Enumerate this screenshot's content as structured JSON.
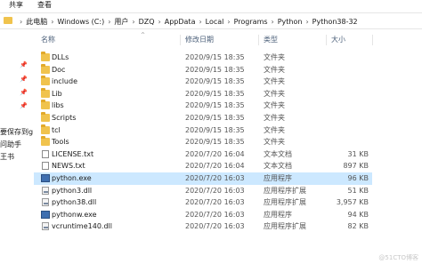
{
  "ribbon": {
    "tabs": [
      "共享",
      "查看"
    ]
  },
  "address": {
    "crumbs": [
      "此电脑",
      "Windows (C:)",
      "用户",
      "DZQ",
      "AppData",
      "Local",
      "Programs",
      "Python",
      "Python38-32"
    ]
  },
  "quick_access": [
    "要保存到g",
    "问助手",
    "王书"
  ],
  "columns": {
    "name": "名称",
    "date": "修改日期",
    "type": "类型",
    "size": "大小"
  },
  "files": [
    {
      "name": "DLLs",
      "date": "2020/9/15 18:35",
      "type": "文件夹",
      "size": "",
      "icon": "folder-icon"
    },
    {
      "name": "Doc",
      "date": "2020/9/15 18:35",
      "type": "文件夹",
      "size": "",
      "icon": "folder-icon"
    },
    {
      "name": "include",
      "date": "2020/9/15 18:35",
      "type": "文件夹",
      "size": "",
      "icon": "folder-icon"
    },
    {
      "name": "Lib",
      "date": "2020/9/15 18:35",
      "type": "文件夹",
      "size": "",
      "icon": "folder-icon"
    },
    {
      "name": "libs",
      "date": "2020/9/15 18:35",
      "type": "文件夹",
      "size": "",
      "icon": "folder-icon"
    },
    {
      "name": "Scripts",
      "date": "2020/9/15 18:35",
      "type": "文件夹",
      "size": "",
      "icon": "folder-icon"
    },
    {
      "name": "tcl",
      "date": "2020/9/15 18:35",
      "type": "文件夹",
      "size": "",
      "icon": "folder-icon"
    },
    {
      "name": "Tools",
      "date": "2020/9/15 18:35",
      "type": "文件夹",
      "size": "",
      "icon": "folder-icon"
    },
    {
      "name": "LICENSE.txt",
      "date": "2020/7/20 16:04",
      "type": "文本文档",
      "size": "31 KB",
      "icon": "text-file-icon"
    },
    {
      "name": "NEWS.txt",
      "date": "2020/7/20 16:04",
      "type": "文本文档",
      "size": "897 KB",
      "icon": "text-file-icon"
    },
    {
      "name": "python.exe",
      "date": "2020/7/20 16:03",
      "type": "应用程序",
      "size": "96 KB",
      "icon": "python-exe-icon",
      "selected": true
    },
    {
      "name": "python3.dll",
      "date": "2020/7/20 16:03",
      "type": "应用程序扩展",
      "size": "51 KB",
      "icon": "dll-icon"
    },
    {
      "name": "python38.dll",
      "date": "2020/7/20 16:03",
      "type": "应用程序扩展",
      "size": "3,957 KB",
      "icon": "dll-icon"
    },
    {
      "name": "pythonw.exe",
      "date": "2020/7/20 16:03",
      "type": "应用程序",
      "size": "94 KB",
      "icon": "python-exe-icon"
    },
    {
      "name": "vcruntime140.dll",
      "date": "2020/7/20 16:03",
      "type": "应用程序扩展",
      "size": "82 KB",
      "icon": "dll-icon"
    }
  ],
  "watermark": "@51CTO博客"
}
